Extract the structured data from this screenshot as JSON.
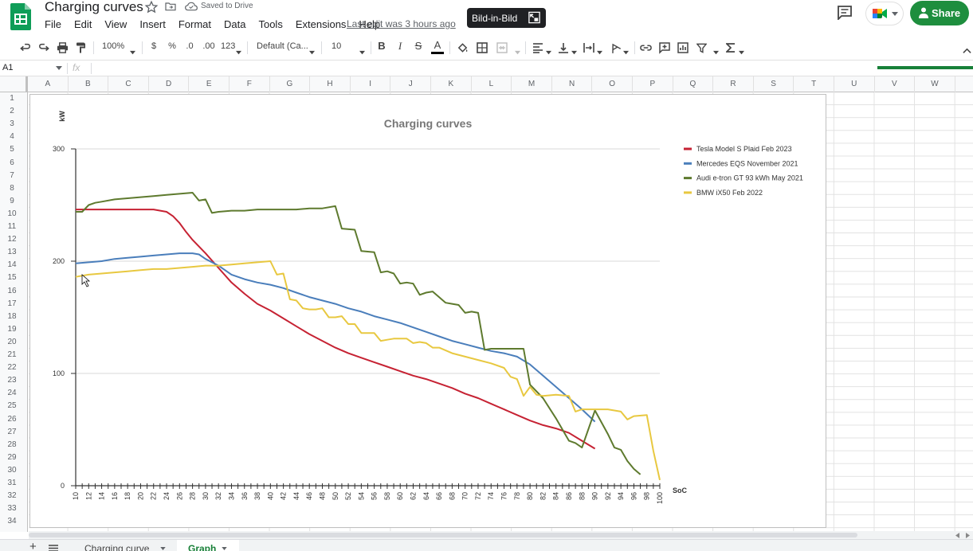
{
  "title_bar": {
    "doc_title": "Charging curves",
    "saved_status": "Saved to Drive",
    "last_edit": "Last edit was 3 hours ago",
    "pip_label": "Bild-in-Bild",
    "share_label": "Share"
  },
  "menu": [
    "File",
    "Edit",
    "View",
    "Insert",
    "Format",
    "Data",
    "Tools",
    "Extensions",
    "Help"
  ],
  "toolbar": {
    "zoom": "100%",
    "currency": "$",
    "percent": "%",
    "dec_decrease": ".0",
    "dec_increase": ".00",
    "more_formats": "123",
    "font": "Default (Ca...",
    "font_size": "10",
    "bold": "B",
    "italic": "I",
    "strike": "S",
    "text_color": "A"
  },
  "formula_bar": {
    "name_box": "A1",
    "fx": "fx"
  },
  "columns": [
    "A",
    "B",
    "C",
    "D",
    "E",
    "F",
    "G",
    "H",
    "I",
    "J",
    "K",
    "L",
    "M",
    "N",
    "O",
    "P",
    "Q",
    "R",
    "S",
    "T",
    "U",
    "V",
    "W"
  ],
  "rows": [
    "1",
    "2",
    "3",
    "4",
    "5",
    "6",
    "7",
    "8",
    "9",
    "10",
    "11",
    "12",
    "13",
    "14",
    "15",
    "16",
    "17",
    "18",
    "19",
    "20",
    "21",
    "22",
    "23",
    "24",
    "25",
    "26",
    "27",
    "28",
    "29",
    "30",
    "31",
    "32",
    "33",
    "34"
  ],
  "sheet_tabs": [
    "Charging curve",
    "Graph"
  ],
  "colors": {
    "brand_green": "#0f9d58",
    "share_green": "#1e8e3e",
    "tesla": "#c62233",
    "mercedes": "#4a7ebb",
    "audi": "#5e7a2e",
    "bmw": "#e8c840"
  },
  "chart_data": {
    "type": "line",
    "title": "Charging curves",
    "ylabel": "kW",
    "xlabel": "SoC",
    "ylim": [
      0,
      300
    ],
    "yticks": [
      0,
      100,
      200,
      300
    ],
    "xlim": [
      10,
      100
    ],
    "xticks": [
      10,
      12,
      14,
      16,
      18,
      20,
      22,
      24,
      26,
      28,
      30,
      32,
      34,
      36,
      38,
      40,
      42,
      44,
      46,
      48,
      50,
      52,
      54,
      56,
      58,
      60,
      62,
      64,
      66,
      68,
      70,
      72,
      74,
      76,
      78,
      80,
      82,
      84,
      86,
      88,
      90,
      92,
      94,
      96,
      98,
      100
    ],
    "grid": true,
    "legend": "top-right",
    "series": [
      {
        "name": "Tesla Model S Plaid Feb 2023",
        "color": "#c62233",
        "x": [
          10,
          12,
          14,
          16,
          18,
          20,
          22,
          24,
          25,
          26,
          27,
          28,
          30,
          32,
          34,
          36,
          38,
          40,
          42,
          44,
          46,
          48,
          50,
          52,
          54,
          56,
          58,
          60,
          62,
          64,
          66,
          68,
          70,
          72,
          74,
          76,
          78,
          80,
          82,
          84,
          86,
          88,
          90
        ],
        "y": [
          246,
          246,
          246,
          246,
          246,
          246,
          246,
          244,
          240,
          234,
          226,
          219,
          207,
          194,
          181,
          171,
          162,
          156,
          149,
          142,
          135,
          129,
          123,
          118,
          114,
          110,
          106,
          102,
          98,
          95,
          91,
          87,
          82,
          78,
          73,
          68,
          63,
          58,
          54,
          51,
          47,
          40,
          33
        ]
      },
      {
        "name": "Mercedes EQS November 2021",
        "color": "#4a7ebb",
        "x": [
          10,
          12,
          14,
          16,
          18,
          20,
          22,
          24,
          26,
          28,
          29,
          30,
          32,
          34,
          36,
          38,
          40,
          42,
          44,
          46,
          48,
          50,
          52,
          54,
          56,
          58,
          60,
          62,
          64,
          66,
          68,
          70,
          72,
          74,
          76,
          78,
          80,
          82,
          84,
          86,
          88,
          90
        ],
        "y": [
          198,
          199,
          200,
          202,
          203,
          204,
          205,
          206,
          207,
          207,
          206,
          202,
          196,
          188,
          184,
          181,
          179,
          176,
          172,
          168,
          165,
          162,
          158,
          155,
          151,
          148,
          145,
          141,
          137,
          133,
          129,
          126,
          123,
          120,
          118,
          115,
          108,
          98,
          88,
          78,
          68,
          57
        ]
      },
      {
        "name": "Audi e-tron GT 93 kWh May 2021",
        "color": "#5e7a2e",
        "x": [
          10,
          11,
          12,
          13,
          14,
          16,
          18,
          20,
          22,
          24,
          26,
          28,
          29,
          30,
          31,
          32,
          34,
          36,
          38,
          40,
          42,
          44,
          46,
          48,
          50,
          51,
          53,
          54,
          56,
          57,
          58,
          59,
          60,
          61,
          62,
          63,
          64,
          65,
          67,
          68,
          69,
          70,
          71,
          72,
          73,
          74,
          75,
          76,
          77,
          78,
          79,
          80,
          82,
          84,
          86,
          87,
          88,
          90,
          92,
          93,
          94,
          95,
          96,
          97
        ],
        "y": [
          244,
          244,
          250,
          252,
          253,
          255,
          256,
          257,
          258,
          259,
          260,
          261,
          254,
          255,
          243,
          244,
          245,
          245,
          246,
          246,
          246,
          246,
          247,
          247,
          249,
          229,
          228,
          209,
          208,
          190,
          191,
          189,
          180,
          181,
          180,
          170,
          172,
          173,
          163,
          162,
          161,
          154,
          155,
          154,
          121,
          122,
          122,
          122,
          122,
          122,
          122,
          90,
          78,
          60,
          40,
          38,
          34,
          67,
          46,
          34,
          32,
          22,
          15,
          10
        ]
      },
      {
        "name": "BMW iX50 Feb 2022",
        "color": "#e8c840",
        "x": [
          10,
          12,
          14,
          16,
          18,
          20,
          22,
          24,
          26,
          28,
          30,
          32,
          34,
          36,
          38,
          40,
          41,
          42,
          43,
          44,
          45,
          46,
          47,
          48,
          49,
          50,
          51,
          52,
          53,
          54,
          55,
          56,
          57,
          58,
          59,
          60,
          61,
          62,
          63,
          64,
          65,
          66,
          68,
          70,
          72,
          74,
          76,
          77,
          78,
          79,
          80,
          81,
          82,
          84,
          86,
          87,
          88,
          90,
          92,
          94,
          95,
          96,
          98,
          99,
          100
        ],
        "y": [
          186,
          188,
          189,
          190,
          191,
          192,
          193,
          193,
          194,
          195,
          196,
          196,
          197,
          198,
          199,
          200,
          188,
          189,
          166,
          165,
          158,
          157,
          157,
          158,
          150,
          150,
          151,
          144,
          144,
          136,
          136,
          136,
          129,
          130,
          131,
          131,
          131,
          127,
          128,
          127,
          123,
          123,
          118,
          115,
          112,
          109,
          105,
          97,
          95,
          80,
          88,
          81,
          80,
          81,
          80,
          66,
          68,
          68,
          68,
          66,
          59,
          62,
          63,
          31,
          5
        ]
      }
    ]
  }
}
